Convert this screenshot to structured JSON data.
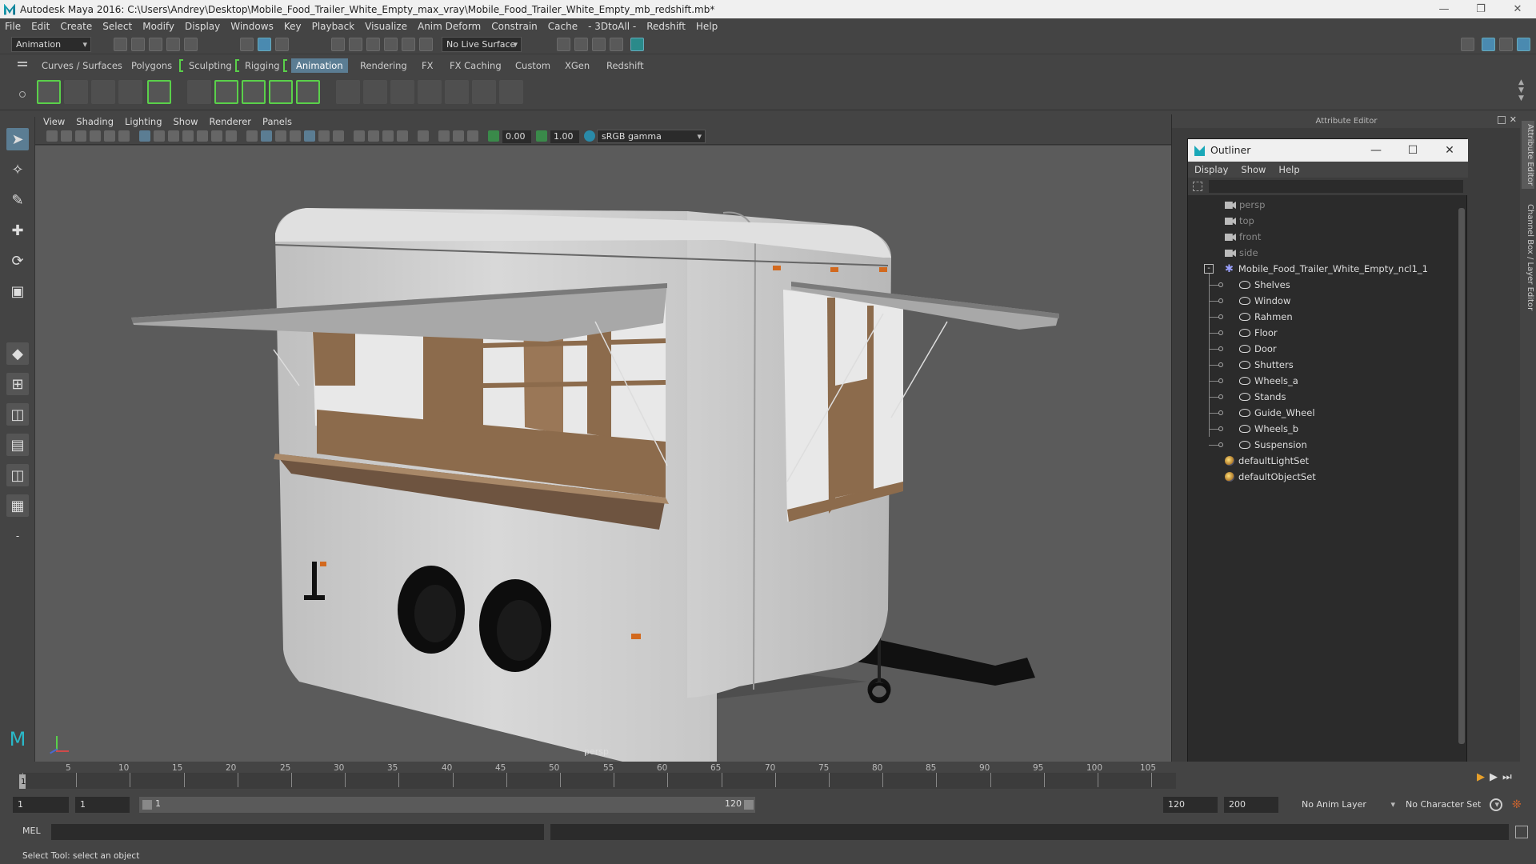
{
  "window": {
    "title": "Autodesk Maya 2016: C:\\Users\\Andrey\\Desktop\\Mobile_Food_Trailer_White_Empty_max_vray\\Mobile_Food_Trailer_White_Empty_mb_redshift.mb*"
  },
  "menubar": [
    "File",
    "Edit",
    "Create",
    "Select",
    "Modify",
    "Display",
    "Windows",
    "Key",
    "Playback",
    "Visualize",
    "Anim Deform",
    "Constrain",
    "Cache",
    "- 3DtoAll -",
    "Redshift",
    "Help"
  ],
  "statusline": {
    "mode": "Animation",
    "live_surface": "No Live Surface"
  },
  "shelf_tabs": [
    "Curves / Surfaces",
    "Polygons",
    "Sculpting",
    "Rigging",
    "Animation",
    "Rendering",
    "FX",
    "FX Caching",
    "Custom",
    "XGen",
    "Redshift"
  ],
  "shelf_active": "Animation",
  "panel_menu": [
    "View",
    "Shading",
    "Lighting",
    "Show",
    "Renderer",
    "Panels"
  ],
  "panel_toolbar": {
    "value_a": "0.00",
    "value_b": "1.00",
    "color_space": "sRGB gamma"
  },
  "viewport": {
    "camera_label": "persp"
  },
  "attribute_editor": {
    "title": "Attribute Editor"
  },
  "outliner": {
    "title": "Outliner",
    "menu": [
      "Display",
      "Show",
      "Help"
    ],
    "cameras": [
      "persp",
      "top",
      "front",
      "side"
    ],
    "group": "Mobile_Food_Trailer_White_Empty_ncl1_1",
    "children": [
      "Shelves",
      "Window",
      "Rahmen",
      "Floor",
      "Door",
      "Shutters",
      "Wheels_a",
      "Stands",
      "Guide_Wheel",
      "Wheels_b",
      "Suspension"
    ],
    "sets": [
      "defaultLightSet",
      "defaultObjectSet"
    ]
  },
  "side_tabs": [
    "Attribute Editor",
    "Channel Box / Layer Editor"
  ],
  "timeline": {
    "labels": [
      "5",
      "10",
      "15",
      "20",
      "25",
      "30",
      "35",
      "40",
      "45",
      "50",
      "55",
      "60",
      "65",
      "70",
      "75",
      "80",
      "85",
      "90",
      "95",
      "100",
      "105"
    ],
    "current_frame": "1"
  },
  "range": {
    "start": "1",
    "playback_start": "1",
    "range_start": "1",
    "range_end": "120",
    "playback_end": "120",
    "end": "200",
    "anim_layer": "No Anim Layer",
    "char_set": "No Character Set"
  },
  "cmdline": {
    "lang": "MEL"
  },
  "helpline": {
    "text": "Select Tool: select an object"
  }
}
